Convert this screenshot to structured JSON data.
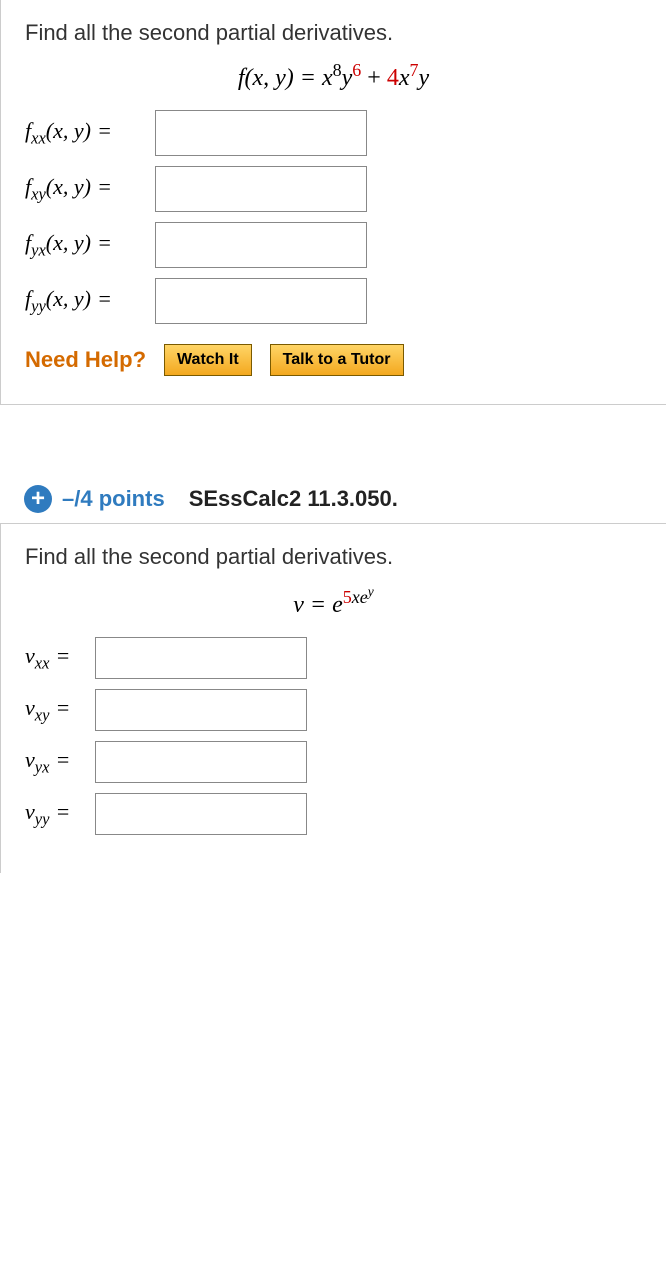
{
  "q1": {
    "prompt": "Find all the second partial derivatives.",
    "formula": {
      "lhs": "f(x, y) = ",
      "base1": "x",
      "exp1_black": "8",
      "base2": "y",
      "exp2_red": "6",
      "plus": " + ",
      "coef_red": "4",
      "base3": "x",
      "exp3_red": "7",
      "base4": "y"
    },
    "rows": [
      {
        "var": "f",
        "sub": "xx",
        "args": "(x, y)"
      },
      {
        "var": "f",
        "sub": "xy",
        "args": "(x, y)"
      },
      {
        "var": "f",
        "sub": "yx",
        "args": "(x, y)"
      },
      {
        "var": "f",
        "sub": "yy",
        "args": "(x, y)"
      }
    ],
    "help": {
      "label": "Need Help?",
      "watch": "Watch It",
      "tutor": "Talk to a Tutor"
    }
  },
  "header": {
    "points": "–/4 points",
    "reference": "SEssCalc2 11.3.050."
  },
  "q2": {
    "prompt": "Find all the second partial derivatives.",
    "formula": {
      "lhs": "v = e",
      "exp_prefix_red": "5",
      "exp_mid": "xe",
      "exp_sup": "y"
    },
    "rows": [
      {
        "var": "v",
        "sub": "xx"
      },
      {
        "var": "v",
        "sub": "xy"
      },
      {
        "var": "v",
        "sub": "yx"
      },
      {
        "var": "v",
        "sub": "yy"
      }
    ]
  }
}
